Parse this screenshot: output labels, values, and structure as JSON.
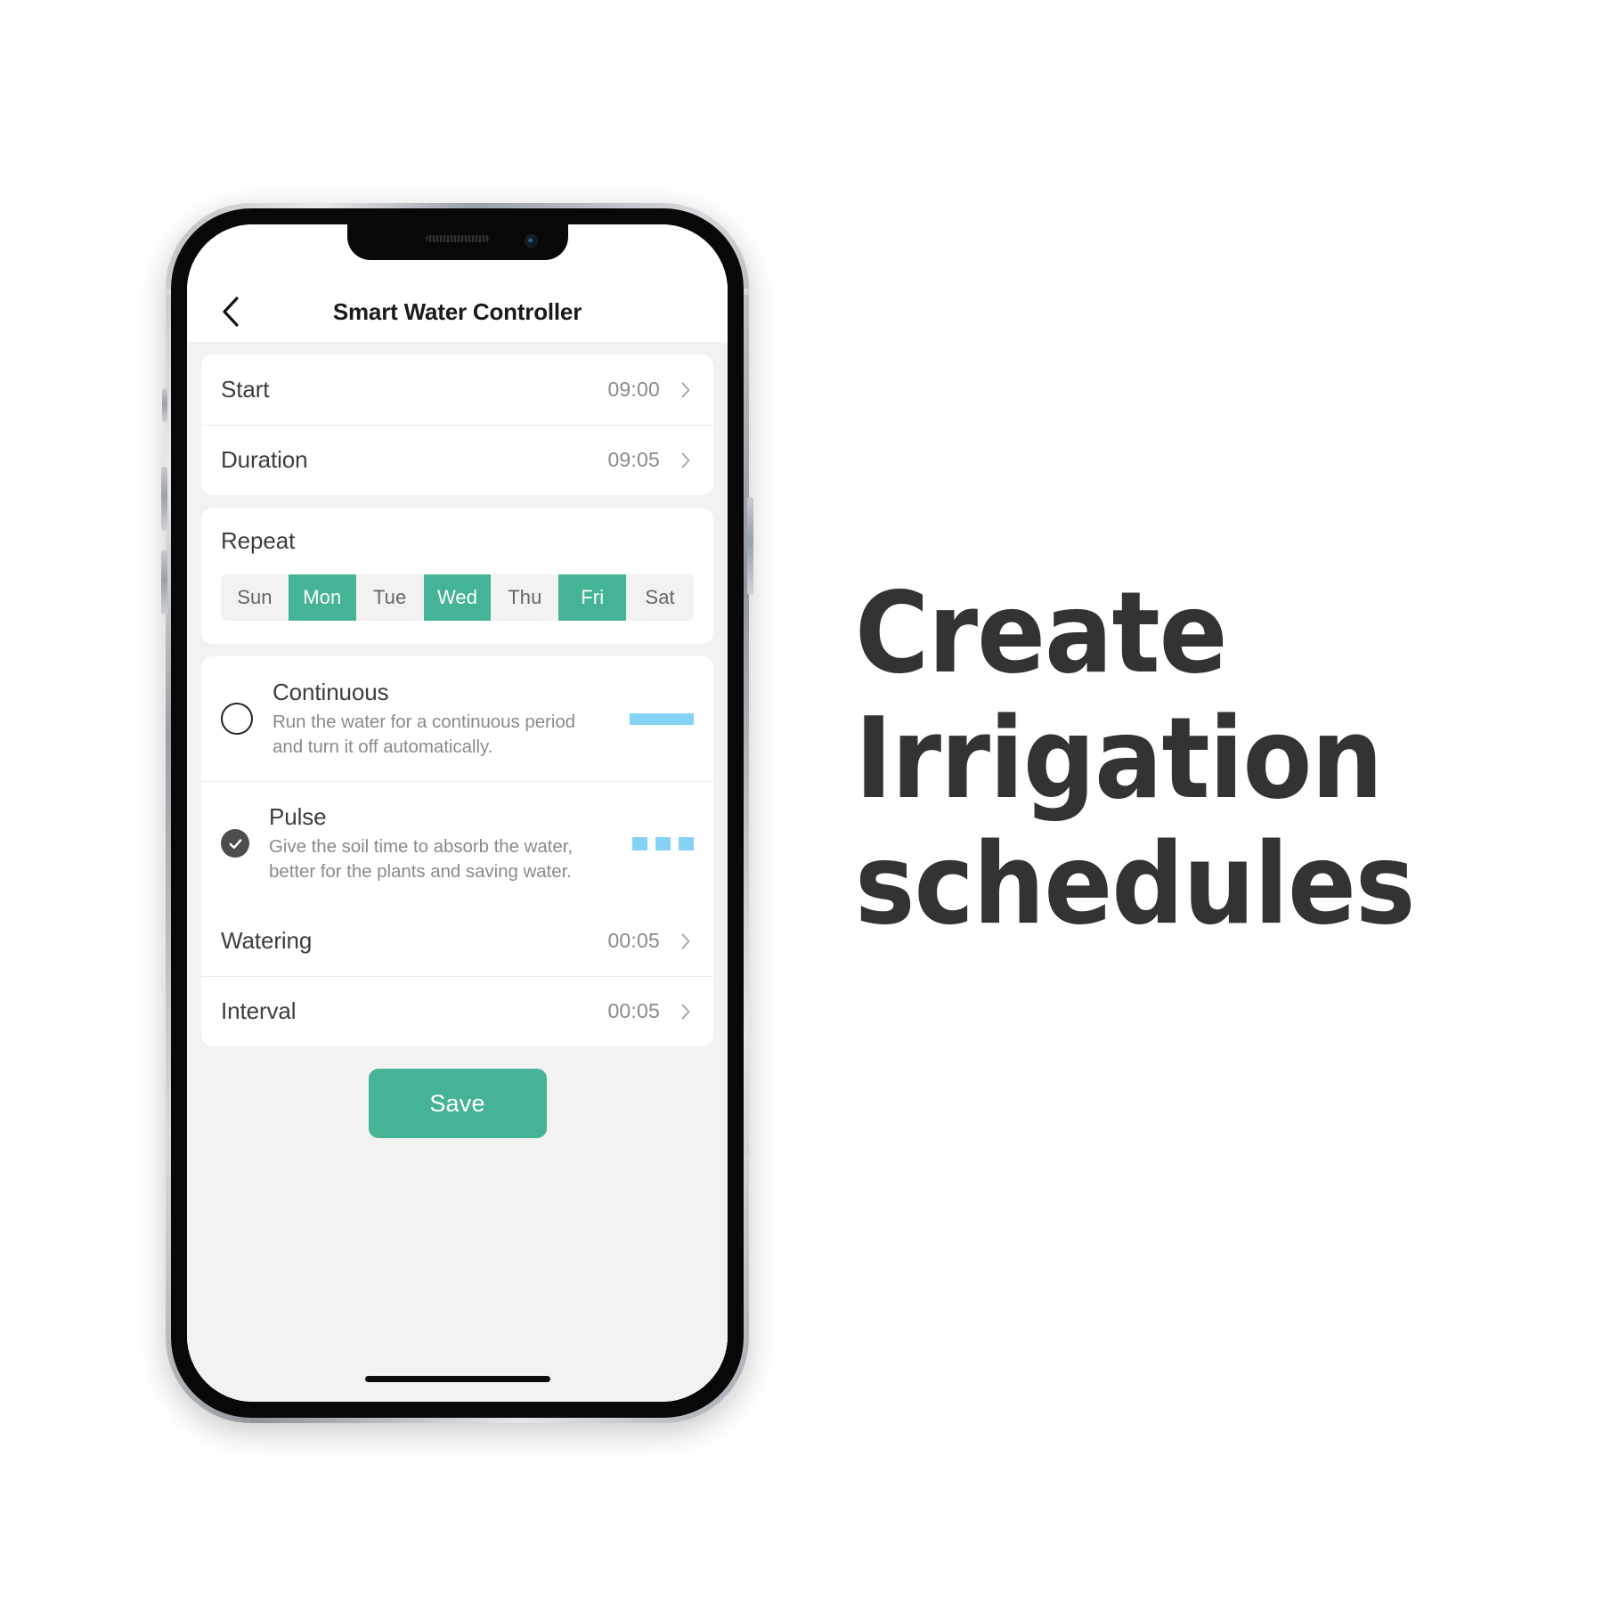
{
  "phone": {
    "app": {
      "nav": {
        "back_icon": "chevron-left-icon",
        "title": "Smart Water Controller"
      },
      "schedule_card": {
        "rows": [
          {
            "label": "Start",
            "value": "09:00",
            "chevron": "chevron-right-icon"
          },
          {
            "label": "Duration",
            "value": "09:05",
            "chevron": "chevron-right-icon"
          }
        ]
      },
      "repeat_card": {
        "title": "Repeat",
        "days": [
          {
            "label": "Sun",
            "selected": false
          },
          {
            "label": "Mon",
            "selected": true
          },
          {
            "label": "Tue",
            "selected": false
          },
          {
            "label": "Wed",
            "selected": true
          },
          {
            "label": "Thu",
            "selected": false
          },
          {
            "label": "Fri",
            "selected": true
          },
          {
            "label": "Sat",
            "selected": false
          }
        ]
      },
      "mode_card": {
        "modes": [
          {
            "title": "Continuous",
            "description": "Run the water for a continuous period and turn it off automatically.",
            "selected": false,
            "indicator": "solid-bar"
          },
          {
            "title": "Pulse",
            "description": "Give the soil time to absorb the water, better for the plants and saving water.",
            "selected": true,
            "indicator": "dashed-bars"
          }
        ],
        "rows": [
          {
            "label": "Watering",
            "value": "00:05",
            "chevron": "chevron-right-icon"
          },
          {
            "label": "Interval",
            "value": "00:05",
            "chevron": "chevron-right-icon"
          }
        ]
      },
      "save_button": "Save"
    }
  },
  "headline": {
    "line1": "Create",
    "line2": "Irrigation",
    "line3": "schedules"
  },
  "colors": {
    "accent_green": "#45b396",
    "indicator_blue": "#84d2f4",
    "screen_bg": "#f2f2f2",
    "card_bg": "#ffffff",
    "label_text": "#3d3d3d",
    "value_text": "#8a8a8a",
    "headline_text": "#333333"
  }
}
